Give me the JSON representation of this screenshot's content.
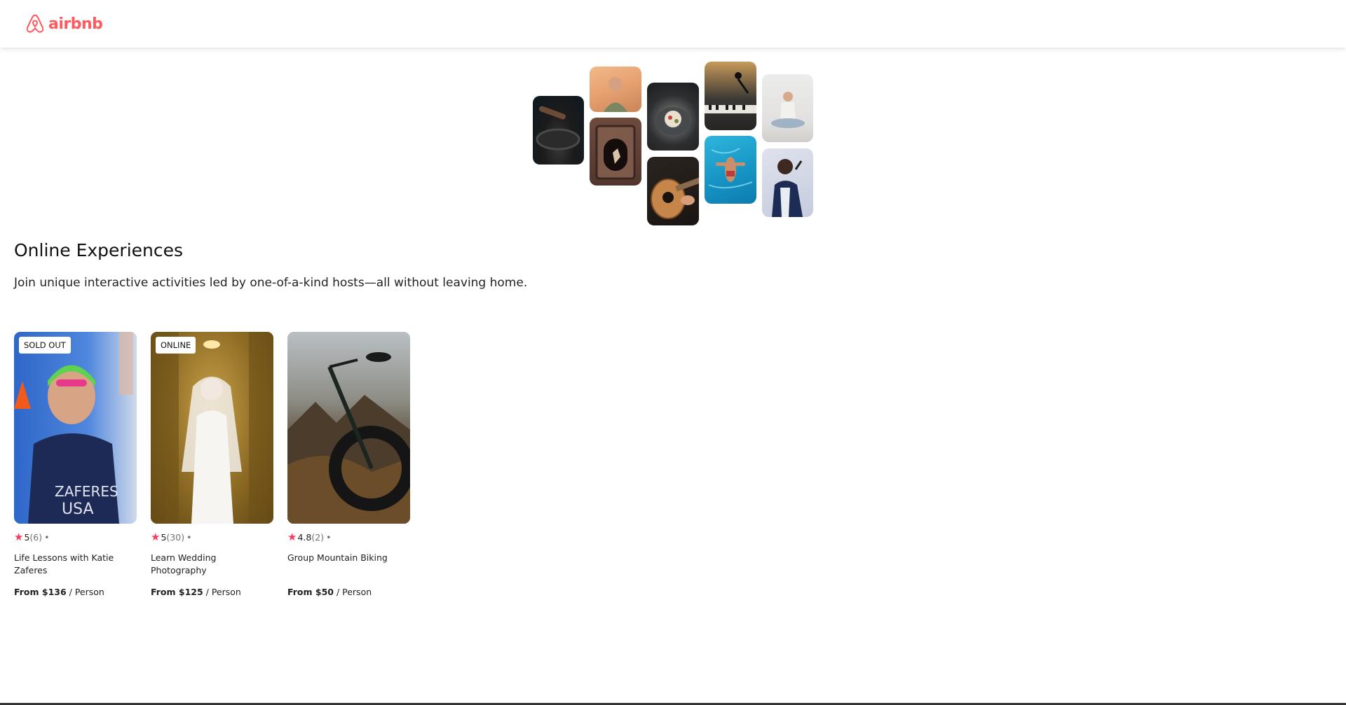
{
  "header": {
    "logo_text": "airbnb",
    "brand_color": "#ff5a5f"
  },
  "hero": {
    "images": [
      {
        "name": "cooking-pan-photo"
      },
      {
        "name": "woman-smiling-photo"
      },
      {
        "name": "fireplace-dancer-photo"
      },
      {
        "name": "food-bowl-photo"
      },
      {
        "name": "guitar-player-photo"
      },
      {
        "name": "piano-microphone-photo"
      },
      {
        "name": "swimmer-pool-photo"
      },
      {
        "name": "meditation-photo"
      },
      {
        "name": "singer-performer-photo"
      }
    ]
  },
  "section": {
    "title": "Online Experiences",
    "subtitle": "Join unique interactive activities led by one-of-a-kind hosts—all without leaving home."
  },
  "cards": [
    {
      "badge": "SOLD OUT",
      "star": "★",
      "rating": "5",
      "count": "(6)",
      "dot": "•",
      "title": "Life Lessons with Katie Zaferes",
      "price_label": "From $136",
      "price_unit": "/ Person",
      "image": "swimmer-katie-photo"
    },
    {
      "badge": "ONLINE",
      "star": "★",
      "rating": "5",
      "count": "(30)",
      "dot": "•",
      "title": "Learn Wedding Photography",
      "price_label": "From $125",
      "price_unit": "/ Person",
      "image": "bride-photo"
    },
    {
      "badge": "",
      "star": "★",
      "rating": "4.8",
      "count": "(2)",
      "dot": "•",
      "title": "Group Mountain Biking",
      "price_label": "From $50",
      "price_unit": "/ Person",
      "image": "mountain-bike-photo"
    }
  ],
  "colors": {
    "star": "#fe385c",
    "muted": "#717171"
  }
}
